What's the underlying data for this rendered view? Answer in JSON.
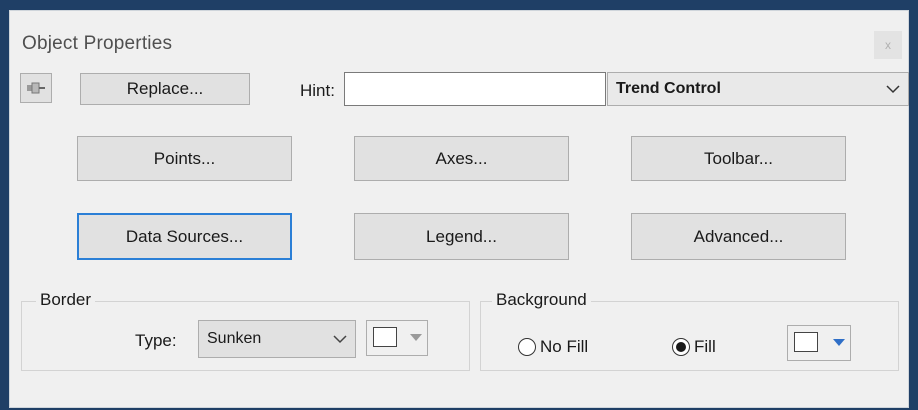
{
  "window": {
    "title": "Object Properties",
    "close_glyph": "x"
  },
  "toolbar": {
    "pin_icon": "pushpin-icon",
    "replace_label": "Replace...",
    "hint_label": "Hint:",
    "hint_value": "",
    "object_type": "Trend Control"
  },
  "buttons": {
    "points": "Points...",
    "axes": "Axes...",
    "toolbar": "Toolbar...",
    "data_sources": "Data Sources...",
    "legend": "Legend...",
    "advanced": "Advanced..."
  },
  "border": {
    "group_label": "Border",
    "type_label": "Type:",
    "type_value": "Sunken",
    "color": "#ffffff"
  },
  "background": {
    "group_label": "Background",
    "no_fill_label": "No Fill",
    "fill_label": "Fill",
    "selected": "Fill",
    "color": "#ffffff"
  },
  "colors": {
    "focus": "#2b7fd6",
    "frame": "#1f3f66",
    "dropdown_arrow_active": "#2f6fc7"
  }
}
